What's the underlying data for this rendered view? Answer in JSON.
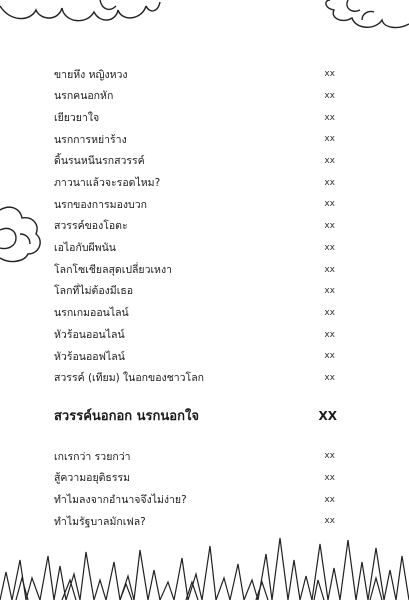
{
  "toc_part1": [
    {
      "title": "ขายหึง หญิงหวง",
      "page": "xx"
    },
    {
      "title": "นรกคนอกหัก",
      "page": "xx"
    },
    {
      "title": "เยียวยาใจ",
      "page": "xx"
    },
    {
      "title": "นรกการหย่าร้าง",
      "page": "xx"
    },
    {
      "title": "ดิ้นรนหนีนรกสวรรค์",
      "page": "xx"
    },
    {
      "title": "ภาวนาแล้วจะรอดไหม?",
      "page": "xx"
    },
    {
      "title": "นรกของการมองบวก",
      "page": "xx"
    },
    {
      "title": "สวรรค์ของโอตะ",
      "page": "xx"
    },
    {
      "title": "เอไอกับผีพนัน",
      "page": "xx"
    },
    {
      "title": "โลกโซเชียลสุดเปลี่ยวเหงา",
      "page": "xx"
    },
    {
      "title": "โลกที่ไม่ต้องมีเธอ",
      "page": "xx"
    },
    {
      "title": "นรกเกมออนไลน์",
      "page": "xx"
    },
    {
      "title": "หัวร้อนออนไลน์",
      "page": "xx"
    },
    {
      "title": "หัวร้อนออฟไลน์",
      "page": "xx"
    },
    {
      "title": "สวรรค์ (เทียม) ในอกของชาวโลก",
      "page": "xx"
    }
  ],
  "section": {
    "title": "สวรรค์นอกอก นรกนอกใจ",
    "page": "XX"
  },
  "toc_part2": [
    {
      "title": "เกเรกว่า รวยกว่า",
      "page": "xx"
    },
    {
      "title": "สู้ความอยุติธรรม",
      "page": "xx"
    },
    {
      "title": "ทำไมลงจากอำนาจจึงไม่ง่าย?",
      "page": "xx"
    },
    {
      "title": "ทำไมรัฐบาลมักเฟล?",
      "page": "xx"
    }
  ]
}
